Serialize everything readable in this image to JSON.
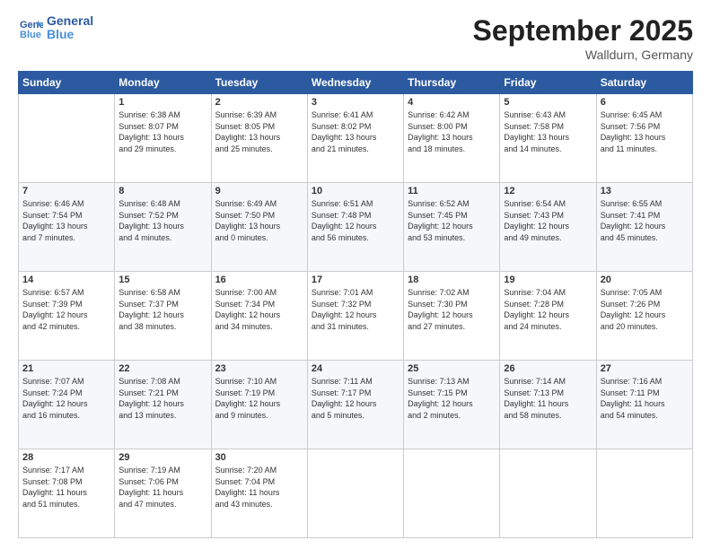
{
  "logo": {
    "text1": "General",
    "text2": "Blue"
  },
  "header": {
    "title": "September 2025",
    "location": "Walldurn, Germany"
  },
  "weekdays": [
    "Sunday",
    "Monday",
    "Tuesday",
    "Wednesday",
    "Thursday",
    "Friday",
    "Saturday"
  ],
  "weeks": [
    [
      {
        "num": "",
        "info": ""
      },
      {
        "num": "1",
        "info": "Sunrise: 6:38 AM\nSunset: 8:07 PM\nDaylight: 13 hours\nand 29 minutes."
      },
      {
        "num": "2",
        "info": "Sunrise: 6:39 AM\nSunset: 8:05 PM\nDaylight: 13 hours\nand 25 minutes."
      },
      {
        "num": "3",
        "info": "Sunrise: 6:41 AM\nSunset: 8:02 PM\nDaylight: 13 hours\nand 21 minutes."
      },
      {
        "num": "4",
        "info": "Sunrise: 6:42 AM\nSunset: 8:00 PM\nDaylight: 13 hours\nand 18 minutes."
      },
      {
        "num": "5",
        "info": "Sunrise: 6:43 AM\nSunset: 7:58 PM\nDaylight: 13 hours\nand 14 minutes."
      },
      {
        "num": "6",
        "info": "Sunrise: 6:45 AM\nSunset: 7:56 PM\nDaylight: 13 hours\nand 11 minutes."
      }
    ],
    [
      {
        "num": "7",
        "info": "Sunrise: 6:46 AM\nSunset: 7:54 PM\nDaylight: 13 hours\nand 7 minutes."
      },
      {
        "num": "8",
        "info": "Sunrise: 6:48 AM\nSunset: 7:52 PM\nDaylight: 13 hours\nand 4 minutes."
      },
      {
        "num": "9",
        "info": "Sunrise: 6:49 AM\nSunset: 7:50 PM\nDaylight: 13 hours\nand 0 minutes."
      },
      {
        "num": "10",
        "info": "Sunrise: 6:51 AM\nSunset: 7:48 PM\nDaylight: 12 hours\nand 56 minutes."
      },
      {
        "num": "11",
        "info": "Sunrise: 6:52 AM\nSunset: 7:45 PM\nDaylight: 12 hours\nand 53 minutes."
      },
      {
        "num": "12",
        "info": "Sunrise: 6:54 AM\nSunset: 7:43 PM\nDaylight: 12 hours\nand 49 minutes."
      },
      {
        "num": "13",
        "info": "Sunrise: 6:55 AM\nSunset: 7:41 PM\nDaylight: 12 hours\nand 45 minutes."
      }
    ],
    [
      {
        "num": "14",
        "info": "Sunrise: 6:57 AM\nSunset: 7:39 PM\nDaylight: 12 hours\nand 42 minutes."
      },
      {
        "num": "15",
        "info": "Sunrise: 6:58 AM\nSunset: 7:37 PM\nDaylight: 12 hours\nand 38 minutes."
      },
      {
        "num": "16",
        "info": "Sunrise: 7:00 AM\nSunset: 7:34 PM\nDaylight: 12 hours\nand 34 minutes."
      },
      {
        "num": "17",
        "info": "Sunrise: 7:01 AM\nSunset: 7:32 PM\nDaylight: 12 hours\nand 31 minutes."
      },
      {
        "num": "18",
        "info": "Sunrise: 7:02 AM\nSunset: 7:30 PM\nDaylight: 12 hours\nand 27 minutes."
      },
      {
        "num": "19",
        "info": "Sunrise: 7:04 AM\nSunset: 7:28 PM\nDaylight: 12 hours\nand 24 minutes."
      },
      {
        "num": "20",
        "info": "Sunrise: 7:05 AM\nSunset: 7:26 PM\nDaylight: 12 hours\nand 20 minutes."
      }
    ],
    [
      {
        "num": "21",
        "info": "Sunrise: 7:07 AM\nSunset: 7:24 PM\nDaylight: 12 hours\nand 16 minutes."
      },
      {
        "num": "22",
        "info": "Sunrise: 7:08 AM\nSunset: 7:21 PM\nDaylight: 12 hours\nand 13 minutes."
      },
      {
        "num": "23",
        "info": "Sunrise: 7:10 AM\nSunset: 7:19 PM\nDaylight: 12 hours\nand 9 minutes."
      },
      {
        "num": "24",
        "info": "Sunrise: 7:11 AM\nSunset: 7:17 PM\nDaylight: 12 hours\nand 5 minutes."
      },
      {
        "num": "25",
        "info": "Sunrise: 7:13 AM\nSunset: 7:15 PM\nDaylight: 12 hours\nand 2 minutes."
      },
      {
        "num": "26",
        "info": "Sunrise: 7:14 AM\nSunset: 7:13 PM\nDaylight: 11 hours\nand 58 minutes."
      },
      {
        "num": "27",
        "info": "Sunrise: 7:16 AM\nSunset: 7:11 PM\nDaylight: 11 hours\nand 54 minutes."
      }
    ],
    [
      {
        "num": "28",
        "info": "Sunrise: 7:17 AM\nSunset: 7:08 PM\nDaylight: 11 hours\nand 51 minutes."
      },
      {
        "num": "29",
        "info": "Sunrise: 7:19 AM\nSunset: 7:06 PM\nDaylight: 11 hours\nand 47 minutes."
      },
      {
        "num": "30",
        "info": "Sunrise: 7:20 AM\nSunset: 7:04 PM\nDaylight: 11 hours\nand 43 minutes."
      },
      {
        "num": "",
        "info": ""
      },
      {
        "num": "",
        "info": ""
      },
      {
        "num": "",
        "info": ""
      },
      {
        "num": "",
        "info": ""
      }
    ]
  ]
}
